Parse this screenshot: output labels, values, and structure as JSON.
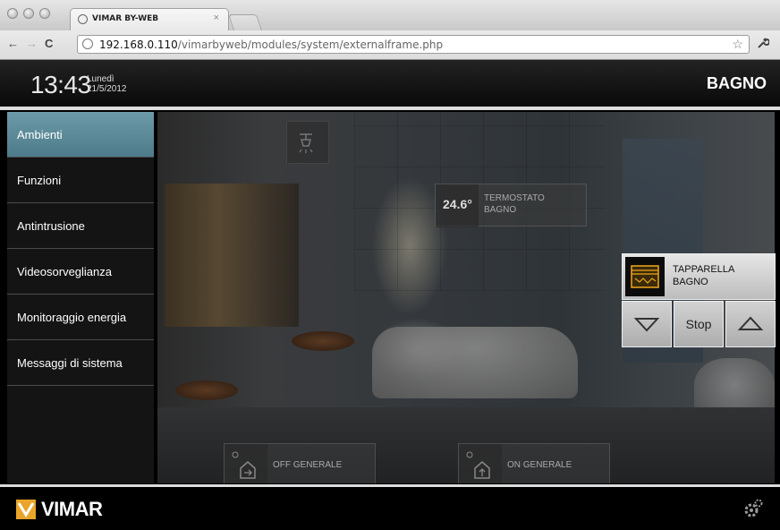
{
  "browser": {
    "tab_title": "VIMAR BY-WEB",
    "tab_close": "×",
    "url_host": "192.168.0.110",
    "url_path": "/vimarbyweb/modules/system/externalframe.php",
    "back": "←",
    "forward": "→",
    "reload": "C",
    "star": "☆",
    "wrench": "🔧"
  },
  "header": {
    "time": "13:43",
    "day": "Lunedì",
    "date": "21/5/2012",
    "room": "BAGNO"
  },
  "sidebar": {
    "items": [
      {
        "label": "Ambienti",
        "active": true
      },
      {
        "label": "Funzioni"
      },
      {
        "label": "Antintrusione"
      },
      {
        "label": "Videosorveglianza"
      },
      {
        "label": "Monitoraggio energia"
      },
      {
        "label": "Messaggi di sistema"
      }
    ]
  },
  "widgets": {
    "thermostat": {
      "value": "24.6°",
      "label_line1": "TERMOSTATO",
      "label_line2": "BAGNO"
    },
    "off_general": {
      "label": "OFF GENERALE"
    },
    "on_general": {
      "label": "ON GENERALE"
    }
  },
  "blind": {
    "label_line1": "TAPPARELLA",
    "label_line2": "BAGNO",
    "stop_label": "Stop",
    "icon": "blind-icon",
    "icon_color": "#f0a81c"
  },
  "footer": {
    "brand": "VIMAR"
  },
  "colors": {
    "active_nav": "#5c8a99",
    "accent": "#f0a81c"
  }
}
